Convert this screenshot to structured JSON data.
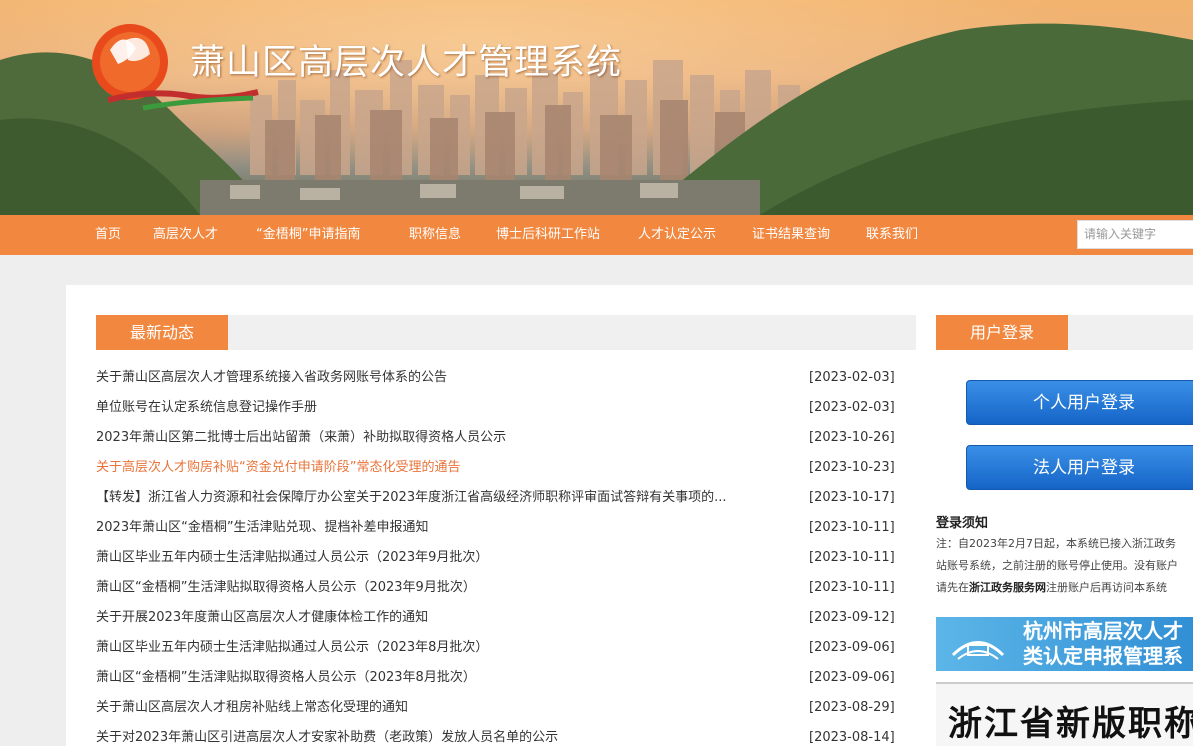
{
  "header": {
    "site_title": "萧山区高层次人才管理系统"
  },
  "nav": {
    "items": [
      "首页",
      "高层次人才",
      "“金梧桐”申请指南",
      "职称信息",
      "博士后科研工作站",
      "人才认定公示",
      "证书结果查询",
      "联系我们"
    ],
    "search_placeholder": "请输入关键字"
  },
  "news": {
    "section_title": "最新动态",
    "items": [
      {
        "title": "关于萧山区高层次人才管理系统接入省政务网账号体系的公告",
        "date": "[2023-02-03]"
      },
      {
        "title": "单位账号在认定系统信息登记操作手册",
        "date": "[2023-02-03]"
      },
      {
        "title": "2023年萧山区第二批博士后出站留萧（来萧）补助拟取得资格人员公示",
        "date": "[2023-10-26]"
      },
      {
        "title": "关于高层次人才购房补贴“资金兑付申请阶段”常态化受理的通告",
        "date": "[2023-10-23]"
      },
      {
        "title": "【转发】浙江省人力资源和社会保障厅办公室关于2023年度浙江省高级经济师职称评审面试答辩有关事项的...",
        "date": "[2023-10-17]"
      },
      {
        "title": "2023年萧山区“金梧桐”生活津贴兑现、提档补差申报通知",
        "date": "[2023-10-11]"
      },
      {
        "title": "萧山区毕业五年内硕士生活津贴拟通过人员公示（2023年9月批次）",
        "date": "[2023-10-11]"
      },
      {
        "title": "萧山区“金梧桐”生活津贴拟取得资格人员公示（2023年9月批次）",
        "date": "[2023-10-11]"
      },
      {
        "title": "关于开展2023年度萧山区高层次人才健康体检工作的通知",
        "date": "[2023-09-12]"
      },
      {
        "title": "萧山区毕业五年内硕士生活津贴拟通过人员公示（2023年8月批次）",
        "date": "[2023-09-06]"
      },
      {
        "title": "萧山区“金梧桐”生活津贴拟取得资格人员公示（2023年8月批次）",
        "date": "[2023-09-06]"
      },
      {
        "title": "关于萧山区高层次人才租房补贴线上常态化受理的通知",
        "date": "[2023-08-29]"
      },
      {
        "title": "关于对2023年萧山区引进高层次人才安家补助费（老政策）发放人员名单的公示",
        "date": "[2023-08-14]"
      }
    ]
  },
  "login": {
    "section_title": "用户登录",
    "personal_button": "个人用户登录",
    "corporate_button": "法人用户登录",
    "notice_title": "登录须知",
    "notice_line1": "注：自2023年2月7日起，本系统已接入浙江政务",
    "notice_line2": "站账号系统，之前注册的账号停止使用。没有账户",
    "notice_line3_pre": "请先在",
    "notice_line3_bold": "浙江政务服务网",
    "notice_line3_post": "注册账户后再访问本系统"
  },
  "ads": {
    "ad1_line1": "杭州市高层次人才",
    "ad1_line2": "类认定申报管理系",
    "ad2_text": "浙江省新版职称系"
  },
  "colors": {
    "accent": "#f2883f",
    "highlight_link": "#e8743b",
    "button_blue": "#1565c8"
  }
}
